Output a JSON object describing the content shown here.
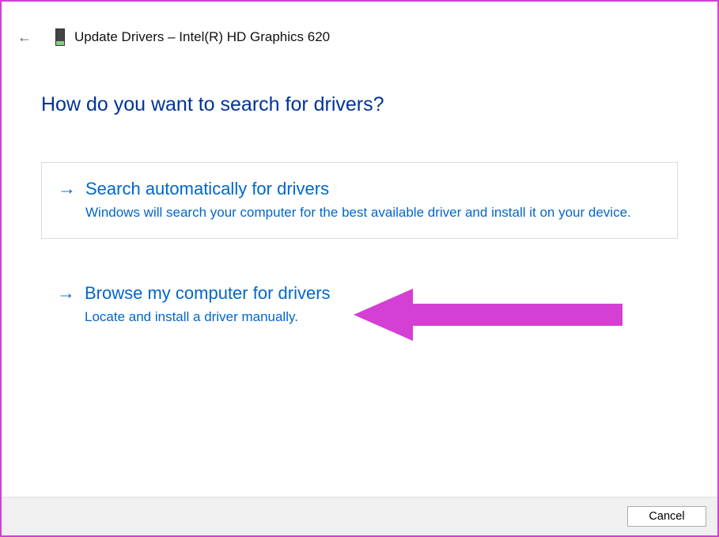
{
  "header": {
    "title": "Update Drivers – Intel(R) HD Graphics 620"
  },
  "heading": "How do you want to search for drivers?",
  "options": {
    "auto": {
      "title": "Search automatically for drivers",
      "desc": "Windows will search your computer for the best available driver and install it on your device."
    },
    "browse": {
      "title": "Browse my computer for drivers",
      "desc": "Locate and install a driver manually."
    }
  },
  "footer": {
    "cancel": "Cancel"
  },
  "annotation": {
    "color": "#d43fd4"
  }
}
